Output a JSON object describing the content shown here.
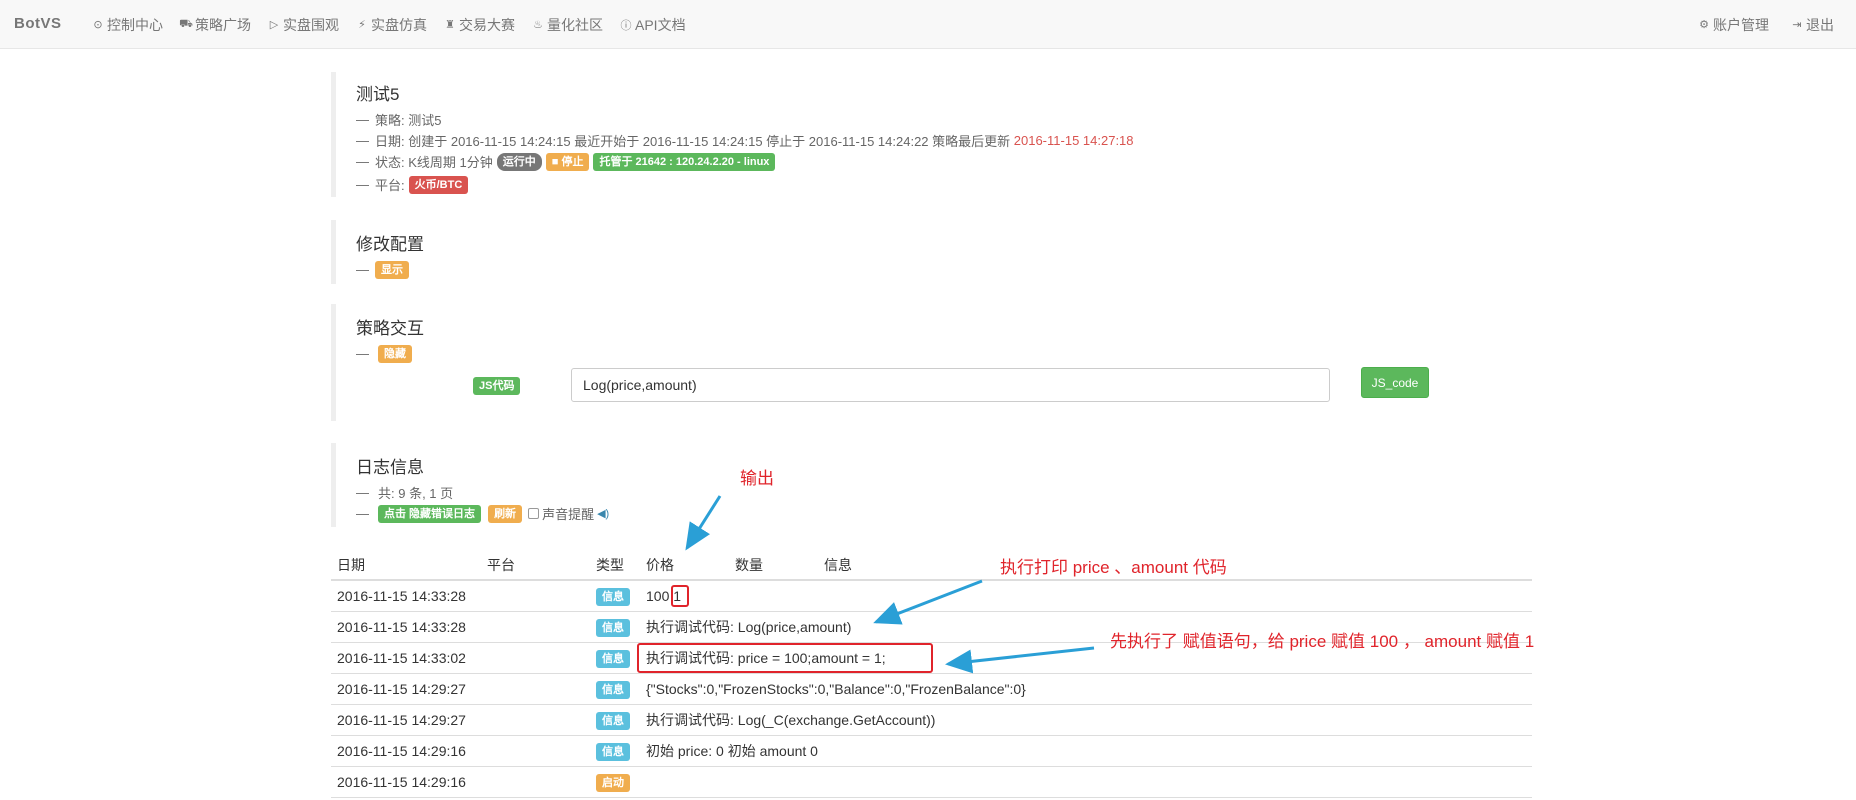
{
  "nav": {
    "brand": "BotVS",
    "left": [
      {
        "icon": "clock-icon",
        "glyph": "⊙",
        "label": "控制中心"
      },
      {
        "icon": "cart-icon",
        "glyph": "⛟",
        "label": "策略广场"
      },
      {
        "icon": "play-circle-icon",
        "glyph": "▷",
        "label": "实盘围观"
      },
      {
        "icon": "flash-icon",
        "glyph": "⚡",
        "label": "实盘仿真"
      },
      {
        "icon": "tower-icon",
        "glyph": "♜",
        "label": "交易大赛"
      },
      {
        "icon": "fire-icon",
        "glyph": "♨",
        "label": "量化社区"
      },
      {
        "icon": "info-circle-icon",
        "glyph": "ⓘ",
        "label": "API文档"
      }
    ],
    "right": [
      {
        "icon": "cog-icon",
        "glyph": "⚙",
        "label": "账户管理"
      },
      {
        "icon": "logout-icon",
        "glyph": "⇥",
        "label": "退出"
      }
    ]
  },
  "robot": {
    "title": "测试5",
    "strategy_prefix": "策略:",
    "strategy_name": "测试5",
    "date_text": "日期: 创建于 2016-11-15 14:24:15 最近开始于 2016-11-15 14:24:15 停止于 2016-11-15 14:24:22 策略最后更新",
    "last_update": "2016-11-15 14:27:18",
    "status_text": "状态: K线周期 1分钟",
    "status_running": "运行中",
    "stop_button": "■ 停止",
    "host_label": "托管于 21642 : 120.24.2.20 - linux",
    "platform_prefix": "平台:",
    "platform_label": "火币/BTC"
  },
  "config": {
    "title": "修改配置",
    "toggle": "显示"
  },
  "interaction": {
    "title": "策略交互",
    "toggle": "隐藏",
    "js_label": "JS代码",
    "input_value": "Log(price,amount)",
    "button": "JS_code"
  },
  "logs": {
    "title": "日志信息",
    "summary": "共: 9 条, 1 页",
    "hide_errors_button": "点击 隐藏错误日志",
    "refresh_button": "刷新",
    "sound_label": "声音提醒",
    "headers": {
      "date": "日期",
      "platform": "平台",
      "type": "类型",
      "price": "价格",
      "amount": "数量",
      "info": "信息"
    },
    "rows": [
      {
        "date": "2016-11-15 14:33:28",
        "platform": "",
        "type": "信息",
        "type_color": "#5bc0de",
        "price": "100",
        "amount": "1",
        "info": ""
      },
      {
        "date": "2016-11-15 14:33:28",
        "platform": "",
        "type": "信息",
        "type_color": "#5bc0de",
        "message": "执行调试代码: Log(price,amount)"
      },
      {
        "date": "2016-11-15 14:33:02",
        "platform": "",
        "type": "信息",
        "type_color": "#5bc0de",
        "message": "执行调试代码: price = 100;amount = 1;"
      },
      {
        "date": "2016-11-15 14:29:27",
        "platform": "",
        "type": "信息",
        "type_color": "#5bc0de",
        "message": "{\"Stocks\":0,\"FrozenStocks\":0,\"Balance\":0,\"FrozenBalance\":0}"
      },
      {
        "date": "2016-11-15 14:29:27",
        "platform": "",
        "type": "信息",
        "type_color": "#5bc0de",
        "message": "执行调试代码: Log(_C(exchange.GetAccount))"
      },
      {
        "date": "2016-11-15 14:29:16",
        "platform": "",
        "type": "信息",
        "type_color": "#5bc0de",
        "message": "初始 price: 0 初始 amount 0"
      },
      {
        "date": "2016-11-15 14:29:16",
        "platform": "",
        "type": "启动",
        "type_color": "#f0ad4e",
        "message": ""
      }
    ]
  },
  "annotations": {
    "output": "输出",
    "exec_print": "执行打印 price 、amount 代码",
    "assign_first": "先执行了 赋值语句，给 price 赋值 100 ， amount 赋值 1"
  }
}
